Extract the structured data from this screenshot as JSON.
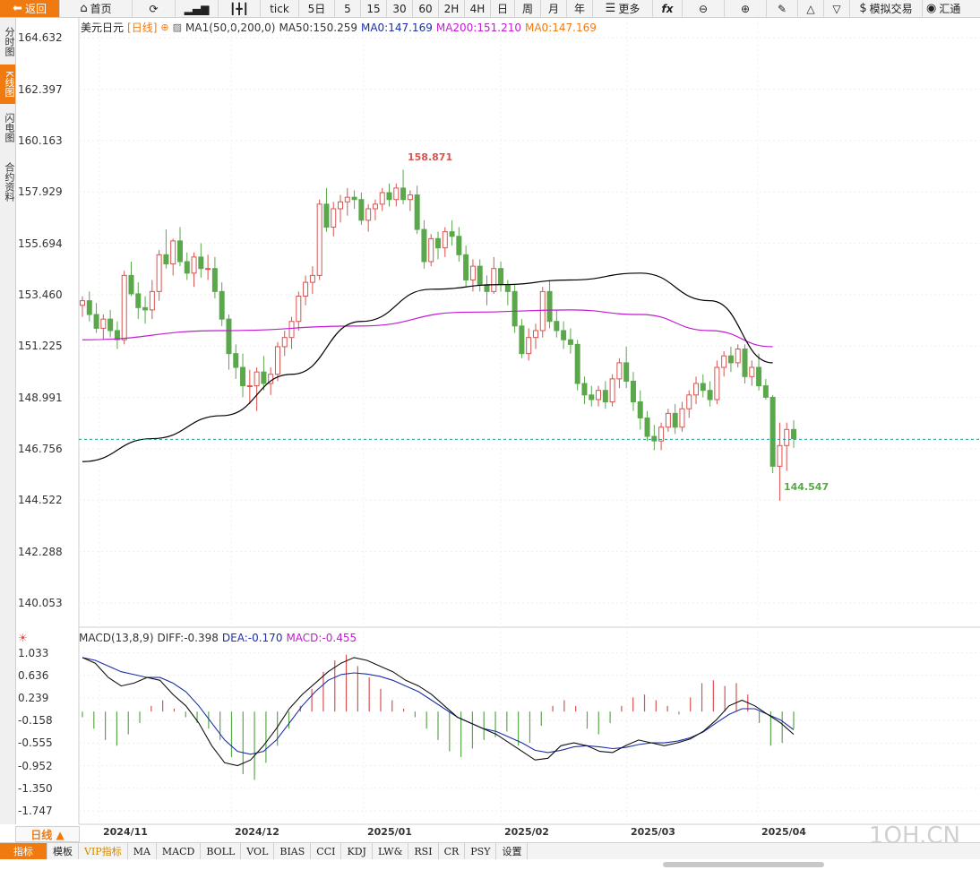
{
  "toolbar": {
    "back": "返回",
    "home": "首页",
    "refresh": "",
    "chart": "",
    "candles": "",
    "tick": "tick",
    "p5day": "5日",
    "p5": "5",
    "p15": "15",
    "p30": "30",
    "p60": "60",
    "p2h": "2H",
    "p4h": "4H",
    "day": "日",
    "week": "周",
    "month": "月",
    "year": "年",
    "more": "更多",
    "fx": "fx",
    "demo_trade": "模拟交易",
    "exchange": "汇通"
  },
  "sidetabs": [
    "分时图",
    "K线图",
    "闪电图",
    "合约资料"
  ],
  "legend": {
    "name": "美元日元",
    "period": "[日线]",
    "ma1": "MA1(50,0,200,0)",
    "ma50": "MA50:150.259",
    "ma0": "MA0:147.169",
    "ma200": "MA200:151.210",
    "ma0b": "MA0:147.169"
  },
  "macd_legend": {
    "name": "MACD(13,8,9)",
    "diff": "DIFF:-0.398",
    "dea": "DEA:-0.170",
    "macd": "MACD:-0.455"
  },
  "colors": {
    "up": "#d9534f",
    "down": "#5aa84b",
    "ma50": "#000000",
    "ma200": "#c21bd2",
    "ma0": "#f07a10",
    "dea": "#1a2fa8",
    "macd": "#c21bd2",
    "last": "#2a9a8a",
    "accent": "#f07a10"
  },
  "price_labels": [
    "164.632",
    "162.397",
    "160.163",
    "157.929",
    "155.694",
    "153.460",
    "151.225",
    "148.991",
    "146.756",
    "144.522",
    "142.288",
    "140.053"
  ],
  "macd_labels": [
    "1.033",
    "0.636",
    "0.239",
    "-0.158",
    "-0.555",
    "-0.952",
    "-1.350",
    "-1.747"
  ],
  "date_labels": [
    "2024/11",
    "2024/12",
    "2025/01",
    "2025/02",
    "2025/03",
    "2025/04"
  ],
  "high_mark": "158.871",
  "low_mark": "144.547",
  "period_button": "日线 ▲",
  "bottom_tabs": [
    "指标",
    "模板",
    "VIP指标",
    "MA",
    "MACD",
    "BOLL",
    "VOL",
    "BIAS",
    "CCI",
    "KDJ",
    "LW&",
    "RSI",
    "CR",
    "PSY",
    "设置"
  ],
  "watermark": "1QH.CN",
  "chart_data": {
    "type": "candlestick",
    "instrument": "美元日元",
    "period": "日线",
    "ylim": [
      139.0,
      165.5
    ],
    "last_price": 147.169,
    "high": 158.871,
    "low": 144.547,
    "candles": [
      [
        153.0,
        153.4,
        152.5,
        153.2
      ],
      [
        153.2,
        153.6,
        152.3,
        152.6
      ],
      [
        152.6,
        153.1,
        151.8,
        152.0
      ],
      [
        152.0,
        152.6,
        151.5,
        152.4
      ],
      [
        152.4,
        152.8,
        151.6,
        151.9
      ],
      [
        151.9,
        152.3,
        151.1,
        151.5
      ],
      [
        151.5,
        154.5,
        151.3,
        154.3
      ],
      [
        154.3,
        154.9,
        153.4,
        153.5
      ],
      [
        153.5,
        154.0,
        152.4,
        152.9
      ],
      [
        152.9,
        153.4,
        152.2,
        152.8
      ],
      [
        152.8,
        154.1,
        152.4,
        153.6
      ],
      [
        153.6,
        155.4,
        153.2,
        155.2
      ],
      [
        155.2,
        156.3,
        154.6,
        154.8
      ],
      [
        154.8,
        155.9,
        154.3,
        155.8
      ],
      [
        155.8,
        156.4,
        154.7,
        154.9
      ],
      [
        154.9,
        155.3,
        154.1,
        154.4
      ],
      [
        154.4,
        155.3,
        153.8,
        155.1
      ],
      [
        155.1,
        155.7,
        154.2,
        154.6
      ],
      [
        154.6,
        155.2,
        154.1,
        154.6
      ],
      [
        154.6,
        155.1,
        153.3,
        153.6
      ],
      [
        153.6,
        154.0,
        152.1,
        152.4
      ],
      [
        152.4,
        152.6,
        150.2,
        150.9
      ],
      [
        150.9,
        151.3,
        149.8,
        150.3
      ],
      [
        150.3,
        150.9,
        149.0,
        149.5
      ],
      [
        149.5,
        150.2,
        148.7,
        149.5
      ],
      [
        149.5,
        150.3,
        148.4,
        150.1
      ],
      [
        150.1,
        150.8,
        149.3,
        149.6
      ],
      [
        149.6,
        150.3,
        149.1,
        150.0
      ],
      [
        150.0,
        151.4,
        149.7,
        151.2
      ],
      [
        151.2,
        151.9,
        150.8,
        151.6
      ],
      [
        151.6,
        152.5,
        151.1,
        152.3
      ],
      [
        152.3,
        153.6,
        151.9,
        153.4
      ],
      [
        153.4,
        154.3,
        153.0,
        154.0
      ],
      [
        154.0,
        154.7,
        153.5,
        154.3
      ],
      [
        154.3,
        157.6,
        154.1,
        157.4
      ],
      [
        157.4,
        158.1,
        156.2,
        156.4
      ],
      [
        156.4,
        157.5,
        156.0,
        157.2
      ],
      [
        157.2,
        157.8,
        156.6,
        157.5
      ],
      [
        157.5,
        158.1,
        156.9,
        157.7
      ],
      [
        157.7,
        158.0,
        157.2,
        157.6
      ],
      [
        157.6,
        157.9,
        156.5,
        156.7
      ],
      [
        156.7,
        157.4,
        156.2,
        157.2
      ],
      [
        157.2,
        157.6,
        156.7,
        157.4
      ],
      [
        157.4,
        158.1,
        157.1,
        157.9
      ],
      [
        157.9,
        158.3,
        157.3,
        157.6
      ],
      [
        157.6,
        158.3,
        157.3,
        158.1
      ],
      [
        158.1,
        158.9,
        157.4,
        157.6
      ],
      [
        157.6,
        158.0,
        157.1,
        157.8
      ],
      [
        157.8,
        158.2,
        156.1,
        156.3
      ],
      [
        156.3,
        156.7,
        154.6,
        154.9
      ],
      [
        154.9,
        156.1,
        154.7,
        155.9
      ],
      [
        155.9,
        156.2,
        155.0,
        155.5
      ],
      [
        155.5,
        156.4,
        155.1,
        156.2
      ],
      [
        156.2,
        156.7,
        155.6,
        156.0
      ],
      [
        156.0,
        156.4,
        154.9,
        155.2
      ],
      [
        155.2,
        155.6,
        153.8,
        154.1
      ],
      [
        154.1,
        155.0,
        153.6,
        154.7
      ],
      [
        154.7,
        155.0,
        153.6,
        153.9
      ],
      [
        153.9,
        154.3,
        153.0,
        153.6
      ],
      [
        153.6,
        155.1,
        153.5,
        154.6
      ],
      [
        154.6,
        154.9,
        153.6,
        153.9
      ],
      [
        153.9,
        154.1,
        153.0,
        153.6
      ],
      [
        153.6,
        153.9,
        151.8,
        152.1
      ],
      [
        152.1,
        152.4,
        150.7,
        150.9
      ],
      [
        150.9,
        152.0,
        150.6,
        151.6
      ],
      [
        151.6,
        152.2,
        151.1,
        151.9
      ],
      [
        151.9,
        153.8,
        151.6,
        153.6
      ],
      [
        153.6,
        154.1,
        152.0,
        152.3
      ],
      [
        152.3,
        152.8,
        151.6,
        151.9
      ],
      [
        151.9,
        152.3,
        151.1,
        151.5
      ],
      [
        151.5,
        152.0,
        150.9,
        151.3
      ],
      [
        151.3,
        151.5,
        149.3,
        149.6
      ],
      [
        149.6,
        149.9,
        148.7,
        149.1
      ],
      [
        149.1,
        149.5,
        148.6,
        148.9
      ],
      [
        148.9,
        149.5,
        148.6,
        149.3
      ],
      [
        149.3,
        149.7,
        148.5,
        148.8
      ],
      [
        148.8,
        150.0,
        148.6,
        149.8
      ],
      [
        149.8,
        150.7,
        149.4,
        150.5
      ],
      [
        150.5,
        151.2,
        149.4,
        149.7
      ],
      [
        149.7,
        150.1,
        148.4,
        148.8
      ],
      [
        148.8,
        149.3,
        147.6,
        148.1
      ],
      [
        148.1,
        148.4,
        147.1,
        147.3
      ],
      [
        147.3,
        147.8,
        146.7,
        147.1
      ],
      [
        147.1,
        147.9,
        146.7,
        147.7
      ],
      [
        147.7,
        148.5,
        147.5,
        148.3
      ],
      [
        148.3,
        148.7,
        147.4,
        147.7
      ],
      [
        147.7,
        148.8,
        147.5,
        148.5
      ],
      [
        148.5,
        149.3,
        148.1,
        149.1
      ],
      [
        149.1,
        149.9,
        148.7,
        149.6
      ],
      [
        149.6,
        150.0,
        149.0,
        149.3
      ],
      [
        149.3,
        149.7,
        148.6,
        148.9
      ],
      [
        148.9,
        150.6,
        148.7,
        150.3
      ],
      [
        150.3,
        151.0,
        149.9,
        150.8
      ],
      [
        150.8,
        151.2,
        150.1,
        150.5
      ],
      [
        150.5,
        151.3,
        150.3,
        151.1
      ],
      [
        151.1,
        151.3,
        149.6,
        149.9
      ],
      [
        149.9,
        150.6,
        149.5,
        150.3
      ],
      [
        150.3,
        150.9,
        149.3,
        149.5
      ],
      [
        149.5,
        149.8,
        148.9,
        149.0
      ],
      [
        149.0,
        149.1,
        145.7,
        146.0
      ],
      [
        146.0,
        147.9,
        144.5,
        146.9
      ],
      [
        146.9,
        147.9,
        145.8,
        147.6
      ],
      [
        147.6,
        148.0,
        146.8,
        147.2
      ]
    ],
    "ma50": [
      [
        0,
        146.2
      ],
      [
        10,
        147.2
      ],
      [
        20,
        148.2
      ],
      [
        30,
        150.0
      ],
      [
        40,
        152.3
      ],
      [
        50,
        153.7
      ],
      [
        60,
        153.9
      ],
      [
        70,
        154.1
      ],
      [
        80,
        154.4
      ],
      [
        90,
        153.2
      ],
      [
        99,
        150.5
      ]
    ],
    "ma200": [
      [
        0,
        151.5
      ],
      [
        20,
        151.9
      ],
      [
        40,
        152.1
      ],
      [
        55,
        152.7
      ],
      [
        70,
        152.8
      ],
      [
        80,
        152.6
      ],
      [
        90,
        151.9
      ],
      [
        99,
        151.2
      ]
    ],
    "macd": {
      "ylim": [
        -1.95,
        1.2
      ],
      "diff": [
        0.95,
        0.85,
        0.6,
        0.45,
        0.5,
        0.6,
        0.55,
        0.3,
        0.1,
        -0.2,
        -0.6,
        -0.9,
        -0.95,
        -0.85,
        -0.6,
        -0.3,
        0.05,
        0.3,
        0.5,
        0.7,
        0.85,
        0.95,
        0.9,
        0.8,
        0.7,
        0.55,
        0.45,
        0.3,
        0.1,
        -0.1,
        -0.2,
        -0.3,
        -0.4,
        -0.55,
        -0.7,
        -0.85,
        -0.82,
        -0.6,
        -0.55,
        -0.6,
        -0.7,
        -0.72,
        -0.6,
        -0.5,
        -0.55,
        -0.6,
        -0.55,
        -0.48,
        -0.35,
        -0.15,
        0.1,
        0.2,
        0.1,
        -0.05,
        -0.2,
        -0.4
      ],
      "dea": [
        0.95,
        0.9,
        0.8,
        0.7,
        0.65,
        0.6,
        0.6,
        0.5,
        0.35,
        0.1,
        -0.2,
        -0.5,
        -0.7,
        -0.75,
        -0.7,
        -0.5,
        -0.2,
        0.1,
        0.35,
        0.55,
        0.65,
        0.68,
        0.66,
        0.62,
        0.55,
        0.45,
        0.35,
        0.2,
        0.05,
        -0.1,
        -0.2,
        -0.3,
        -0.35,
        -0.45,
        -0.55,
        -0.68,
        -0.72,
        -0.68,
        -0.62,
        -0.6,
        -0.62,
        -0.65,
        -0.63,
        -0.58,
        -0.55,
        -0.55,
        -0.52,
        -0.46,
        -0.36,
        -0.2,
        -0.05,
        0.05,
        0.05,
        -0.05,
        -0.15,
        -0.32
      ],
      "hist": [
        -0.1,
        -0.3,
        -0.5,
        -0.6,
        -0.4,
        -0.2,
        0.1,
        0.2,
        0.05,
        -0.1,
        -0.2,
        -0.3,
        -0.5,
        -0.8,
        -1.1,
        -1.2,
        -0.9,
        -0.6,
        -0.3,
        0.1,
        0.4,
        0.7,
        0.9,
        1.0,
        0.8,
        0.6,
        0.4,
        0.2,
        0.05,
        -0.1,
        -0.3,
        -0.5,
        -0.7,
        -0.8,
        -0.65,
        -0.5,
        -0.45,
        -0.35,
        -0.6,
        -0.55,
        -0.25,
        0.1,
        0.2,
        0.1,
        -0.3,
        -0.4,
        -0.2,
        0.1,
        0.25,
        0.3,
        0.2,
        0.1,
        -0.05,
        0.25,
        0.5,
        0.55,
        0.45,
        0.5,
        0.3,
        -0.2,
        -0.6,
        -0.55,
        -0.3
      ]
    }
  }
}
